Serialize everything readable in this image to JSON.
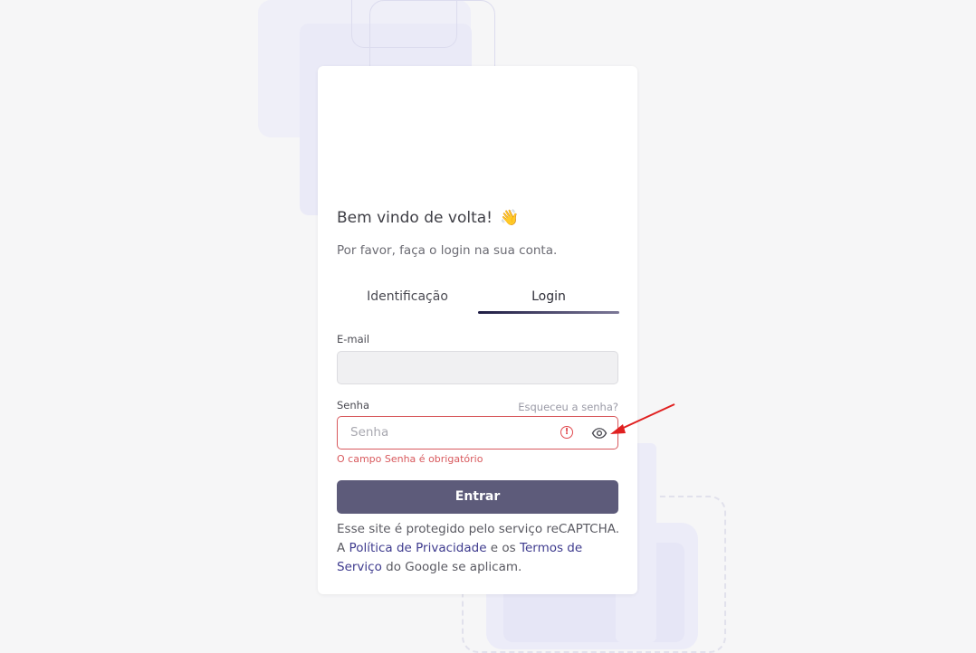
{
  "welcome": {
    "title": "Bem vindo de volta!",
    "emoji": "👋",
    "subtitle": "Por favor, faça o login na sua conta."
  },
  "tabs": [
    {
      "label": "Identificação"
    },
    {
      "label": "Login"
    }
  ],
  "form": {
    "email_label": "E-mail",
    "email_value": "",
    "password_label": "Senha",
    "forgot_label": "Esqueceu a senha?",
    "password_placeholder": "Senha",
    "error_message": "O campo Senha é obrigatório",
    "submit_label": "Entrar"
  },
  "recaptcha": {
    "text1": "Esse site é protegido pelo serviço reCAPTCHA. A ",
    "link1": "Política de Privacidade",
    "text2": " e os ",
    "link2": "Termos de Serviço",
    "text3": " do Google se aplicam."
  },
  "colors": {
    "accent": "#5d5b7a",
    "error": "#d8595d",
    "link": "#3e3b8e",
    "annotation_arrow": "#e02020"
  },
  "icons": {
    "error": "exclamation-circle-icon",
    "toggle_password": "eye-icon",
    "annotation": "red-arrow"
  }
}
